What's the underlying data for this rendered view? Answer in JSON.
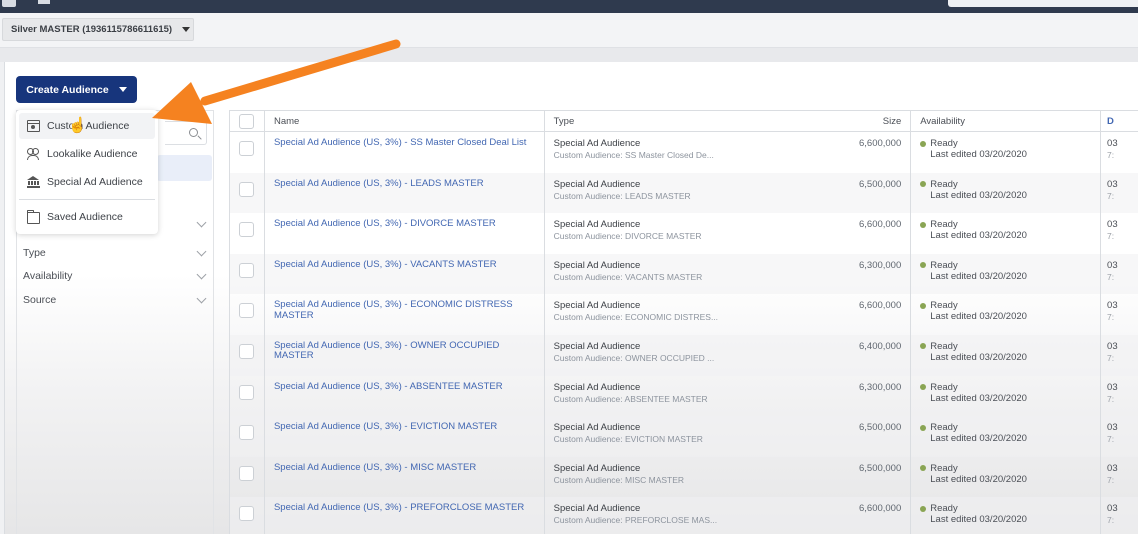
{
  "account": {
    "selector_label": "Silver MASTER (1936115786611615)"
  },
  "toolbar": {
    "create_audience_label": "Create Audience"
  },
  "create_menu": {
    "items": [
      {
        "label": "Custom Audience",
        "icon": "custom-audience-icon",
        "hovered": true
      },
      {
        "label": "Lookalike Audience",
        "icon": "lookalike-icon"
      },
      {
        "label": "Special Ad Audience",
        "icon": "bank-icon"
      },
      {
        "label": "Saved Audience",
        "icon": "folder-icon"
      }
    ]
  },
  "filters": [
    {
      "label": ""
    },
    {
      "label": "Type"
    },
    {
      "label": "Availability"
    },
    {
      "label": "Source"
    }
  ],
  "table": {
    "columns": {
      "name": "Name",
      "type": "Type",
      "size": "Size",
      "availability": "Availability",
      "date": "D"
    },
    "rows": [
      {
        "name": "Special Ad Audience (US, 3%) - SS Master Closed Deal List",
        "type": "Special Ad Audience",
        "type_sub": "Custom Audience: SS Master Closed De...",
        "size": "6,600,000",
        "status": "Ready",
        "edited": "Last edited 03/20/2020",
        "date": "03",
        "time": "7:"
      },
      {
        "name": "Special Ad Audience (US, 3%) - LEADS MASTER",
        "type": "Special Ad Audience",
        "type_sub": "Custom Audience: LEADS MASTER",
        "size": "6,500,000",
        "status": "Ready",
        "edited": "Last edited 03/20/2020",
        "date": "03",
        "time": "7:"
      },
      {
        "name": "Special Ad Audience (US, 3%) - DIVORCE MASTER",
        "type": "Special Ad Audience",
        "type_sub": "Custom Audience: DIVORCE MASTER",
        "size": "6,600,000",
        "status": "Ready",
        "edited": "Last edited 03/20/2020",
        "date": "03",
        "time": "7:"
      },
      {
        "name": "Special Ad Audience (US, 3%) - VACANTS MASTER",
        "type": "Special Ad Audience",
        "type_sub": "Custom Audience: VACANTS MASTER",
        "size": "6,300,000",
        "status": "Ready",
        "edited": "Last edited 03/20/2020",
        "date": "03",
        "time": "7:"
      },
      {
        "name": "Special Ad Audience (US, 3%) - ECONOMIC DISTRESS MASTER",
        "type": "Special Ad Audience",
        "type_sub": "Custom Audience: ECONOMIC DISTRES...",
        "size": "6,600,000",
        "status": "Ready",
        "edited": "Last edited 03/20/2020",
        "date": "03",
        "time": "7:"
      },
      {
        "name": "Special Ad Audience (US, 3%) - OWNER OCCUPIED MASTER",
        "type": "Special Ad Audience",
        "type_sub": "Custom Audience: OWNER OCCUPIED ...",
        "size": "6,400,000",
        "status": "Ready",
        "edited": "Last edited 03/20/2020",
        "date": "03",
        "time": "7:"
      },
      {
        "name": "Special Ad Audience (US, 3%) - ABSENTEE MASTER",
        "type": "Special Ad Audience",
        "type_sub": "Custom Audience: ABSENTEE MASTER",
        "size": "6,300,000",
        "status": "Ready",
        "edited": "Last edited 03/20/2020",
        "date": "03",
        "time": "7:"
      },
      {
        "name": "Special Ad Audience (US, 3%) - EVICTION MASTER",
        "type": "Special Ad Audience",
        "type_sub": "Custom Audience: EVICTION MASTER",
        "size": "6,500,000",
        "status": "Ready",
        "edited": "Last edited 03/20/2020",
        "date": "03",
        "time": "7:"
      },
      {
        "name": "Special Ad Audience (US, 3%) - MISC MASTER",
        "type": "Special Ad Audience",
        "type_sub": "Custom Audience: MISC MASTER",
        "size": "6,500,000",
        "status": "Ready",
        "edited": "Last edited 03/20/2020",
        "date": "03",
        "time": "7:"
      },
      {
        "name": "Special Ad Audience (US, 3%) - PREFORCLOSE MASTER",
        "type": "Special Ad Audience",
        "type_sub": "Custom Audience: PREFORCLOSE MAS...",
        "size": "6,600,000",
        "status": "Ready",
        "edited": "Last edited 03/20/2020",
        "date": "03",
        "time": "7:"
      }
    ]
  },
  "colors": {
    "brand_button": "#17357c",
    "link": "#4267b2",
    "status_ready": "#8aa554",
    "annotation_arrow": "#f58220"
  }
}
